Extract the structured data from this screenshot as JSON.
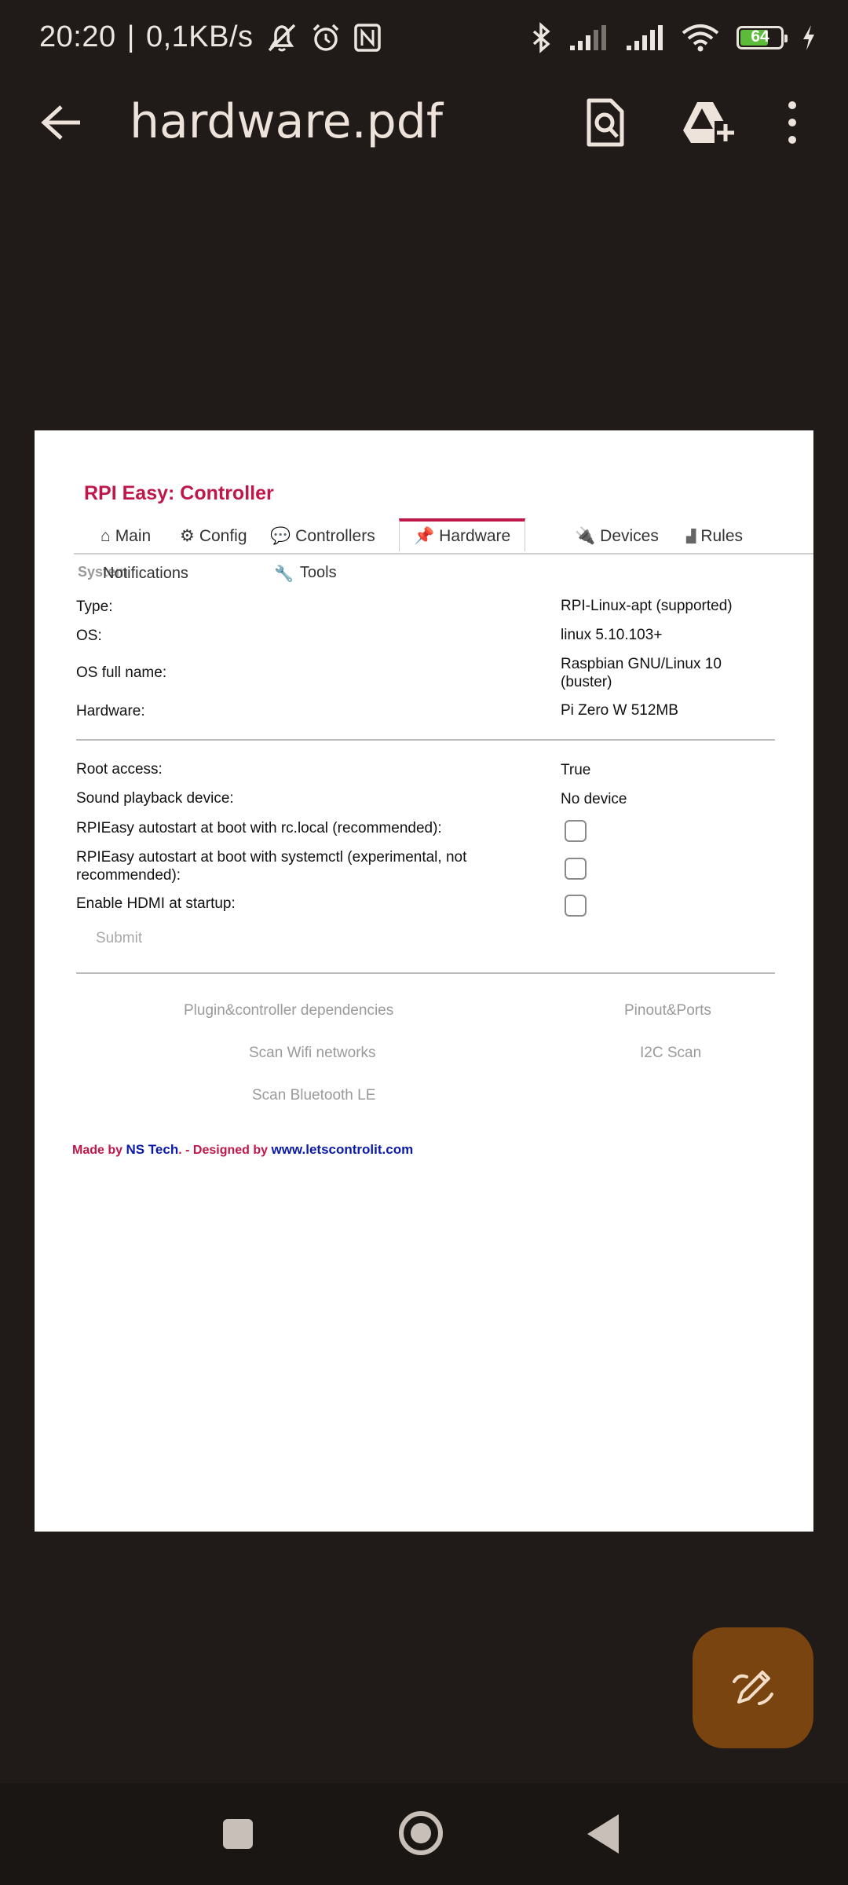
{
  "status_bar": {
    "time": "20:20",
    "separator": "|",
    "speed": "0,1KB/s",
    "battery_level": "64"
  },
  "app_bar": {
    "title": "hardware.pdf"
  },
  "document": {
    "title": "RPI Easy: Controller",
    "tabs": [
      {
        "label": "Main",
        "icon": "home-icon"
      },
      {
        "label": "Config",
        "icon": "gear-icon"
      },
      {
        "label": "Controllers",
        "icon": "speech-bubble-icon"
      },
      {
        "label": "Hardware",
        "icon": "pushpin-icon"
      },
      {
        "label": "Devices",
        "icon": "plug-icon"
      },
      {
        "label": "Rules",
        "icon": "chart-icon"
      }
    ],
    "tabs_row2": {
      "system": "System",
      "notifications": "Notifications",
      "tools": "Tools"
    },
    "info": [
      {
        "label": "Type:",
        "value": "RPI-Linux-apt (supported)"
      },
      {
        "label": "OS:",
        "value": "linux 5.10.103+"
      },
      {
        "label": "OS full name:",
        "value": "Raspbian GNU/Linux 10 (buster)"
      },
      {
        "label": "Hardware:",
        "value": "Pi Zero W 512MB"
      }
    ],
    "settings": [
      {
        "label": "Root access:",
        "value": "True"
      },
      {
        "label": "Sound playback device:",
        "value": "No device"
      },
      {
        "label": "RPIEasy autostart at boot with rc.local (recommended):",
        "checked": false
      },
      {
        "label": "RPIEasy autostart at boot with systemctl (experimental, not recommended):",
        "checked": false
      },
      {
        "label": "Enable HDMI at startup:",
        "checked": false
      }
    ],
    "submit_label": "Submit",
    "links": {
      "deps": "Plugin&controller dependencies",
      "pinout": "Pinout&Ports",
      "wifi": "Scan Wifi networks",
      "i2c": "I2C Scan",
      "bt": "Scan Bluetooth LE"
    },
    "footer": {
      "made_by": "Made by",
      "ns": "NS Tech",
      "designed": ". - Designed by",
      "site": "www.letscontrolit.com"
    }
  },
  "colors": {
    "background": "#201b18",
    "accent": "#c0174a",
    "fab": "#7a4410",
    "link_blue": "#0a1aa8"
  }
}
